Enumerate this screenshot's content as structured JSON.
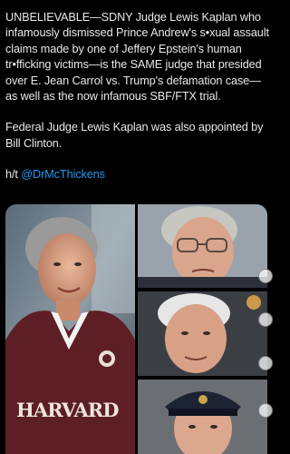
{
  "post": {
    "paragraph1": "UNBELIEVABLE—SDNY Judge Lewis Kaplan who infamously dismissed Prince Andrew's s•xual assault claims made by one of Jeffery Epstein's human tr•fficking victims—is the SAME judge that presided over E. Jean Carrol vs. Trump's defamation case—as well as the now infamous SBF/FTX trial.",
    "paragraph2": "Federal Judge Lewis Kaplan was also appointed by Bill Clinton.",
    "credit_prefix": "h/t ",
    "credit_mention": "@DrMcThickens"
  },
  "media": {
    "photo_left_text": "HARVARD"
  },
  "colors": {
    "background": "#000000",
    "text": "#e7e9ea",
    "mention": "#1d9bf0"
  }
}
